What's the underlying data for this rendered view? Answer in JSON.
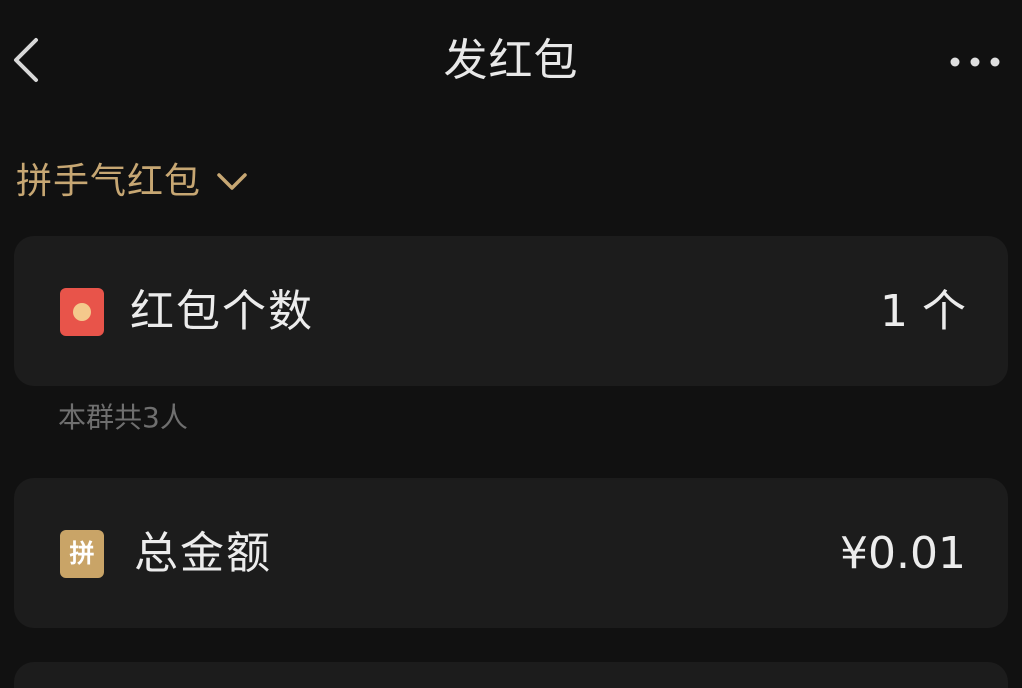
{
  "header": {
    "title": "发红包",
    "back_icon": "chevron-left-icon",
    "more_icon": "more-horizontal-icon"
  },
  "packet_type": {
    "label": "拼手气红包",
    "icon": "chevron-down-icon",
    "color": "#c7a773"
  },
  "count_row": {
    "icon": "red-packet-icon",
    "label": "红包个数",
    "value": "1 个"
  },
  "group_hint": "本群共3人",
  "amount_row": {
    "icon_text": "拼",
    "label": "总金额",
    "value": "¥0.01"
  },
  "colors": {
    "background": "#111111",
    "card": "#1c1c1c",
    "accent_gold": "#c7a773",
    "red_packet": "#e8544a"
  }
}
